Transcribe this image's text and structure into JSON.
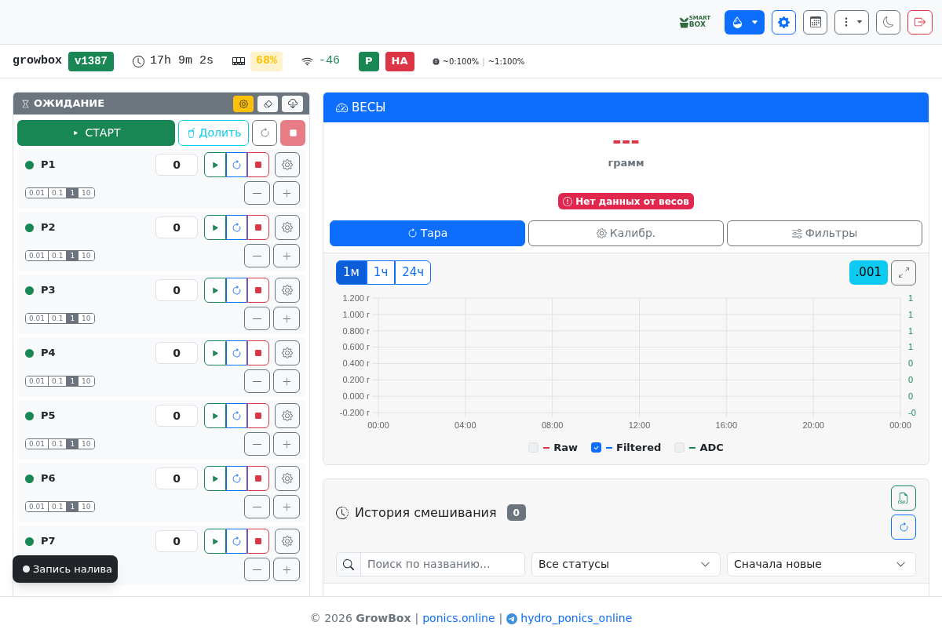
{
  "navbar": {
    "logo": {
      "top": "SMART",
      "bottom": "BOX"
    }
  },
  "status_bar": {
    "hostname": "growbox",
    "version": "v1387",
    "uptime": "17h 9m 2s",
    "memory": "68%",
    "wifi": "-46",
    "badges": [
      {
        "label": "P",
        "color": "#198754"
      },
      {
        "label": "HA",
        "color": "#dc3545"
      }
    ],
    "cores": [
      "~0:100%",
      "~1:100%"
    ],
    "separator": "|"
  },
  "control_panel": {
    "status": "ОЖИДАНИЕ",
    "start": "СТАРТ",
    "top_up": "Долить",
    "stop_disabled": true
  },
  "pumps": [
    {
      "name": "P1",
      "color": "#198754",
      "value": "0",
      "steps": [
        {
          "label": "0.01",
          "selected": false
        },
        {
          "label": "0.1",
          "selected": false
        },
        {
          "label": "1",
          "selected": true
        },
        {
          "label": "10",
          "selected": false
        }
      ]
    },
    {
      "name": "P2",
      "color": "#198754",
      "value": "0",
      "steps": [
        {
          "label": "0.01",
          "selected": false
        },
        {
          "label": "0.1",
          "selected": false
        },
        {
          "label": "1",
          "selected": true
        },
        {
          "label": "10",
          "selected": false
        }
      ]
    },
    {
      "name": "P3",
      "color": "#198754",
      "value": "0",
      "steps": [
        {
          "label": "0.01",
          "selected": false
        },
        {
          "label": "0.1",
          "selected": false
        },
        {
          "label": "1",
          "selected": true
        },
        {
          "label": "10",
          "selected": false
        }
      ]
    },
    {
      "name": "P4",
      "color": "#198754",
      "value": "0",
      "steps": [
        {
          "label": "0.01",
          "selected": false
        },
        {
          "label": "0.1",
          "selected": false
        },
        {
          "label": "1",
          "selected": true
        },
        {
          "label": "10",
          "selected": false
        }
      ]
    },
    {
      "name": "P5",
      "color": "#198754",
      "value": "0",
      "steps": [
        {
          "label": "0.01",
          "selected": false
        },
        {
          "label": "0.1",
          "selected": false
        },
        {
          "label": "1",
          "selected": true
        },
        {
          "label": "10",
          "selected": false
        }
      ]
    },
    {
      "name": "P6",
      "color": "#198754",
      "value": "0",
      "steps": [
        {
          "label": "0.01",
          "selected": false
        },
        {
          "label": "0.1",
          "selected": false
        },
        {
          "label": "1",
          "selected": true
        },
        {
          "label": "10",
          "selected": false
        }
      ]
    },
    {
      "name": "P7",
      "color": "#198754",
      "value": "0"
    }
  ],
  "toast": {
    "text": "Запись налива"
  },
  "scale": {
    "title": "ВЕСЫ",
    "reading": "---",
    "unit": "грамм",
    "alert": "Нет данных от весов",
    "actions": [
      {
        "kind": "tare",
        "label": "Тара"
      },
      {
        "kind": "calibrate",
        "label": "Калибр."
      },
      {
        "kind": "filters",
        "label": "Фильтры"
      }
    ],
    "ranges": [
      {
        "label": "1м",
        "selected": true
      },
      {
        "label": "1ч",
        "selected": false
      },
      {
        "label": "24ч",
        "selected": false
      }
    ],
    "precision": ".001",
    "chart_data": {
      "type": "line",
      "grid": true,
      "categories": [
        "00:00",
        "04:00",
        "08:00",
        "12:00",
        "16:00",
        "20:00",
        "00:00"
      ],
      "ylim": [
        -0.2,
        1.2
      ],
      "yticks": [
        {
          "value": 1.2,
          "label": "1.200 г"
        },
        {
          "value": 1.0,
          "label": "1.000 г"
        },
        {
          "value": 0.8,
          "label": "0.800 г"
        },
        {
          "value": 0.6,
          "label": "0.600 г"
        },
        {
          "value": 0.4,
          "label": "0.400 г"
        },
        {
          "value": 0.2,
          "label": "0.200 г"
        },
        {
          "value": 0.0,
          "label": "0.000 г"
        },
        {
          "value": -0.2,
          "label": "-0.200 г"
        }
      ],
      "y2lim": [
        -0.2,
        1.2
      ],
      "y2ticks": [
        {
          "value": 1.2,
          "label": "1"
        },
        {
          "value": 1.0,
          "label": "1"
        },
        {
          "value": 0.8,
          "label": "1"
        },
        {
          "value": 0.6,
          "label": "1"
        },
        {
          "value": 0.4,
          "label": "0"
        },
        {
          "value": 0.2,
          "label": "0"
        },
        {
          "value": 0.0,
          "label": "0"
        },
        {
          "value": -0.2,
          "label": "-0"
        }
      ],
      "series": [
        {
          "name": "Raw",
          "color": "#dc3545",
          "values": [
            null,
            null,
            null,
            null,
            null,
            null,
            null
          ]
        },
        {
          "name": "Filtered",
          "color": "#0d6efd",
          "values": [
            null,
            null,
            null,
            null,
            null,
            null,
            null
          ]
        },
        {
          "name": "ADC",
          "color": "#198754",
          "values": [
            null,
            null,
            null,
            null,
            null,
            null,
            null
          ]
        }
      ]
    },
    "legend": [
      {
        "checked": false
      },
      {
        "checked": true
      },
      {
        "checked": false
      }
    ]
  },
  "history": {
    "title": "История смешивания",
    "count": "0",
    "search": {
      "placeholder": "Поиск по названию..."
    },
    "selects": [
      {
        "value": "Все статусы"
      },
      {
        "value": "Сначала новые"
      }
    ]
  },
  "footer": {
    "copyright": "© 2026 **GrowBox**",
    "separator": "|",
    "links": [
      {
        "kind": "site",
        "label": "ponics.online"
      },
      {
        "kind": "telegram",
        "label": "hydro_ponics_online"
      }
    ]
  }
}
